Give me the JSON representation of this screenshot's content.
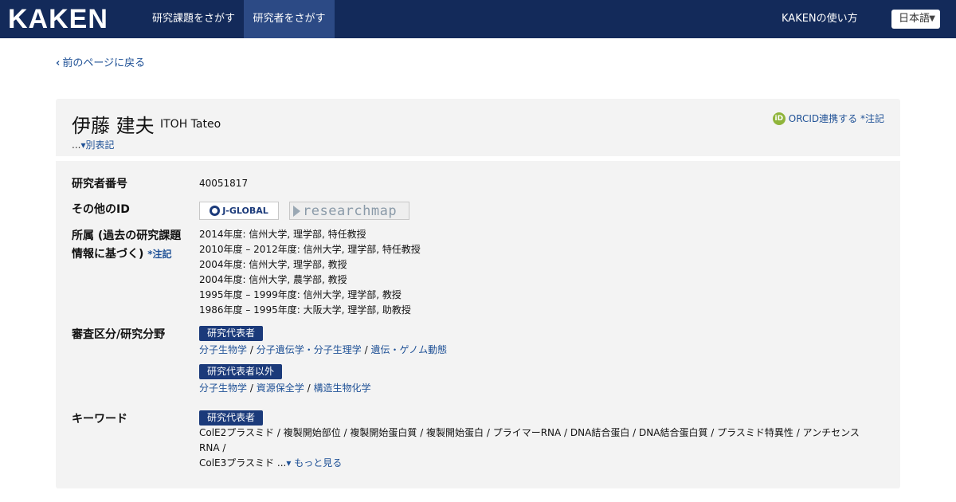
{
  "header": {
    "logo": "KAKEN",
    "tabs": [
      "研究課題をさがす",
      "研究者をさがす"
    ],
    "help_link": "KAKENの使い方",
    "language": "日本語"
  },
  "back_link": "前のページに戻る",
  "researcher": {
    "name_jp": "伊藤 建夫",
    "name_en": "ITOH Tateo",
    "alt_prefix": "...",
    "alt_label": "別表記",
    "orcid_label": "ORCID連携する",
    "orcid_note": "*注記"
  },
  "details": {
    "number_label": "研究者番号",
    "number_value": "40051817",
    "other_id_label": "その他のID",
    "other_ids": [
      "J-GLOBAL",
      "researchmap"
    ],
    "affiliation_label_1": "所属 (過去の研究課題",
    "affiliation_label_2": "情報に基づく)",
    "affiliation_note": "*注記",
    "affiliations": [
      "2014年度: 信州大学, 理学部, 特任教授",
      "2010年度 – 2012年度: 信州大学, 理学部, 特任教授",
      "2004年度: 信州大学, 理学部, 教授",
      "2004年度: 信州大学, 農学部, 教授",
      "1995年度 – 1999年度: 信州大学, 理学部, 教授",
      "1986年度 – 1995年度: 大阪大学, 理学部, 助教授"
    ],
    "field_label": "審査区分/研究分野",
    "field_groups": [
      {
        "tag": "研究代表者",
        "items": [
          "分子生物学",
          "分子遺伝学・分子生理学",
          "遺伝・ゲノム動態"
        ]
      },
      {
        "tag": "研究代表者以外",
        "items": [
          "分子生物学",
          "資源保全学",
          "構造生物化学"
        ]
      }
    ],
    "keyword_label": "キーワード",
    "keyword_tag": "研究代表者",
    "keywords_line1": "ColE2プラスミド / 複製開始部位 / 複製開始蛋白質 / 複製開始蛋白 / プライマーRNA / DNA結合蛋白 / DNA結合蛋白質 / プラスミド特異性 / アンチセンスRNA /",
    "keywords_line2": "ColE3プラスミド",
    "more_prefix": "...",
    "more_label": "もっと見る"
  },
  "colors": {
    "header_bg": "#132a5a",
    "active_tab": "#2c4a85",
    "link": "#1f5196",
    "tag_bg": "#1b3a7a",
    "panel_bg": "#f3f3f3",
    "orcid": "#8fb43a"
  }
}
